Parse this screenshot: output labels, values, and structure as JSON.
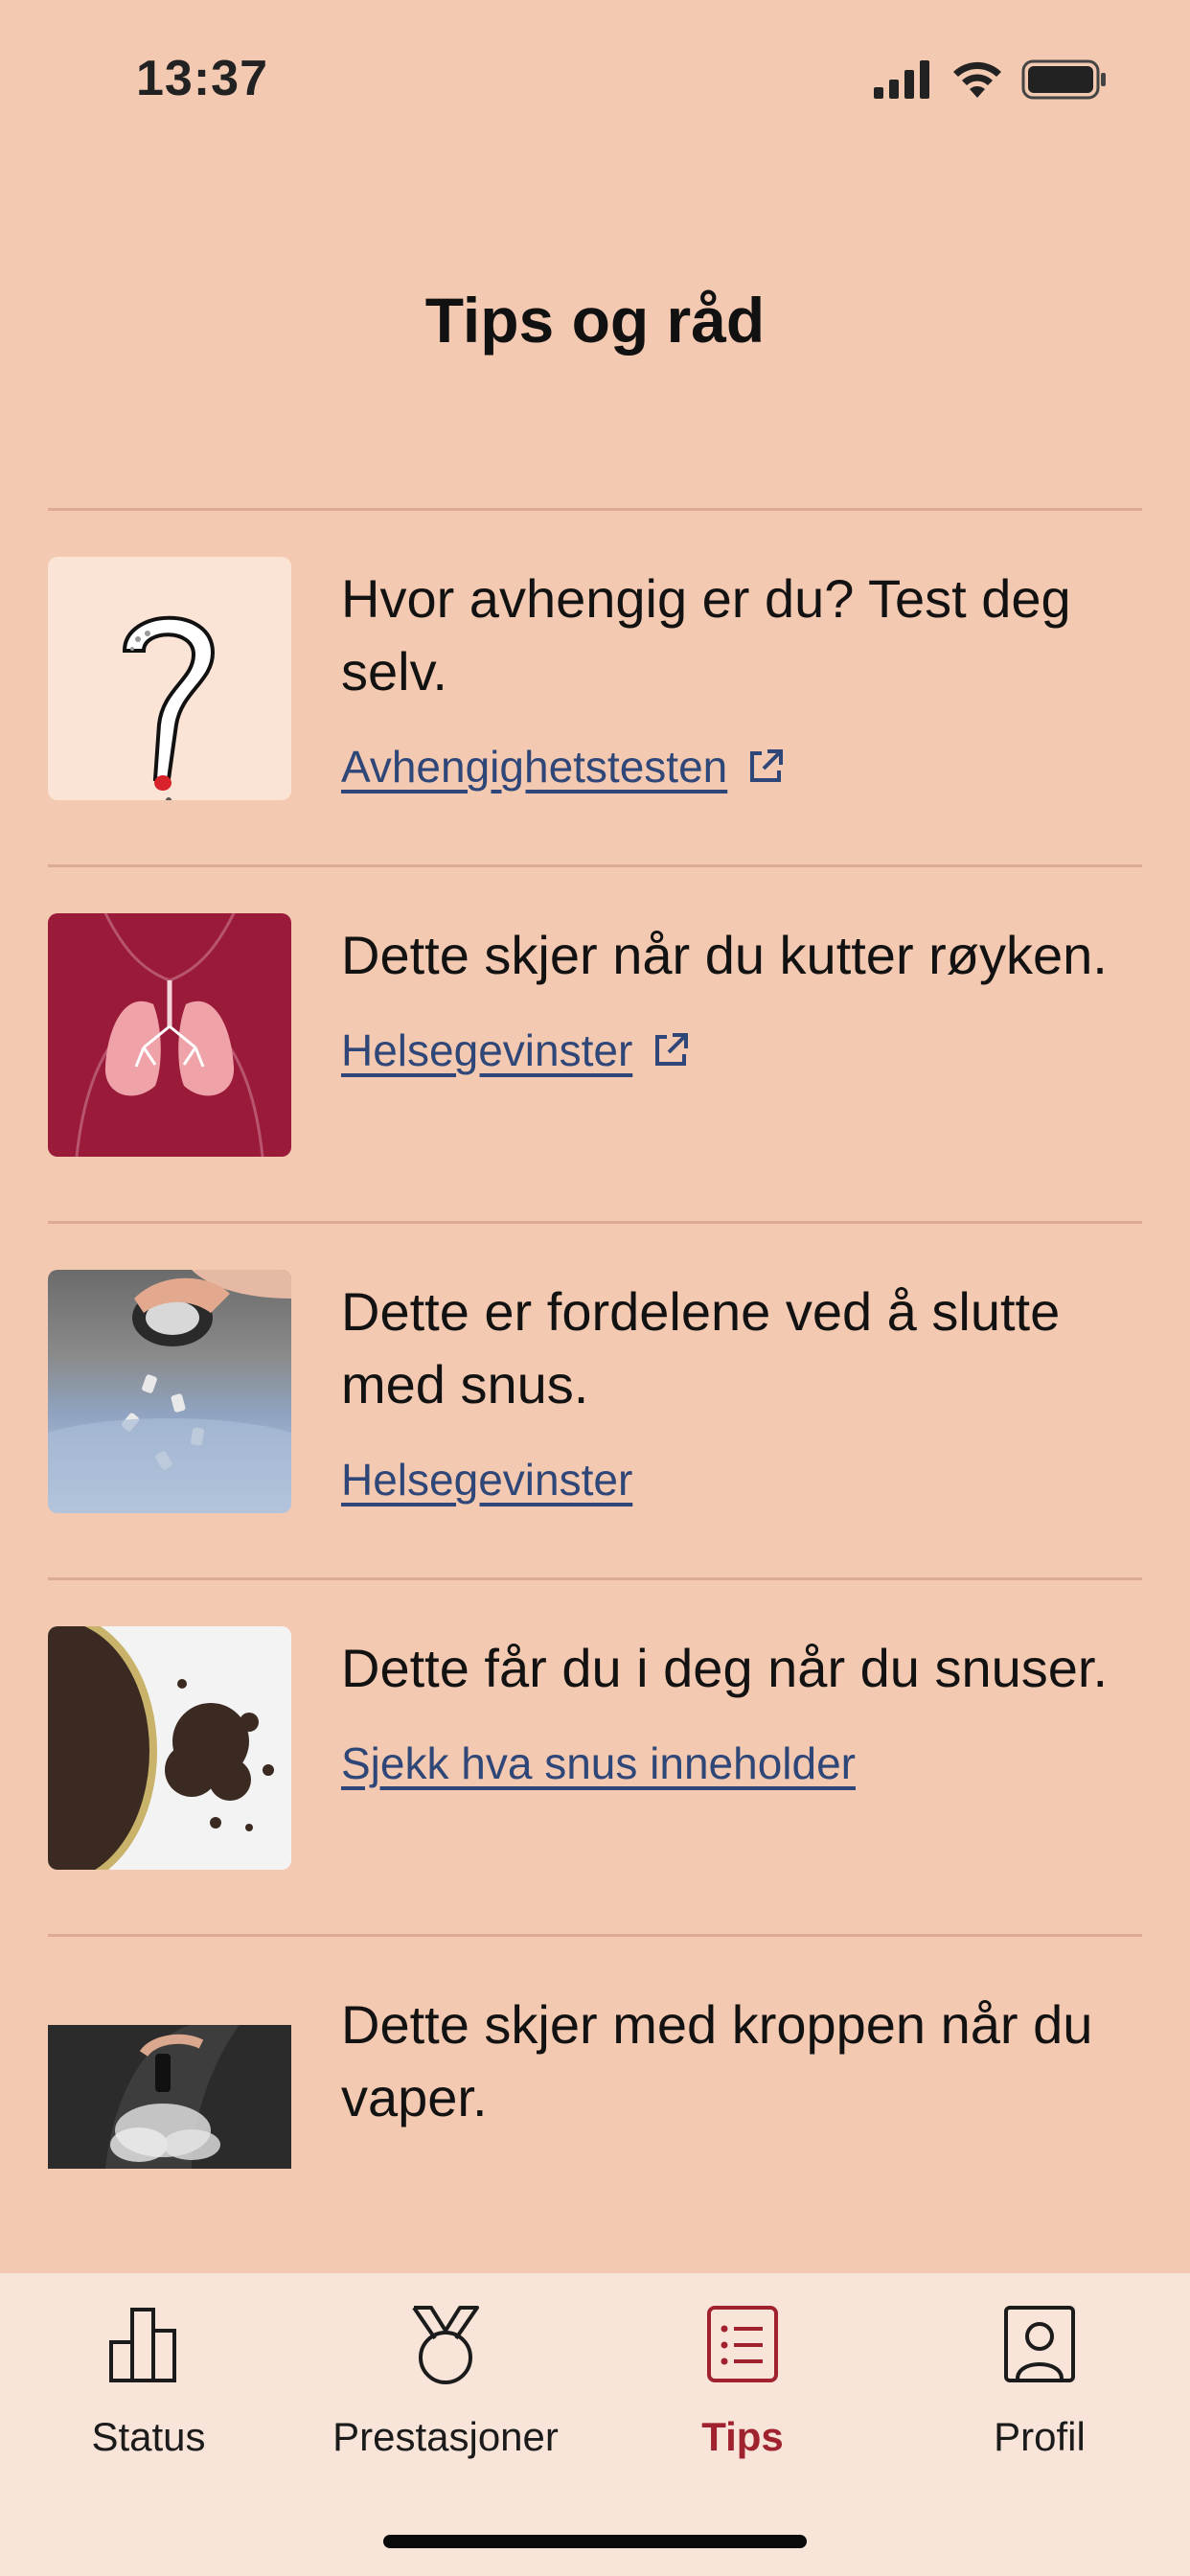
{
  "status_bar": {
    "time": "13:37"
  },
  "header": {
    "title": "Tips og råd"
  },
  "tips": [
    {
      "title": "Hvor avhengig er du? Test deg selv.",
      "link": "Avhengighetstesten",
      "external": true,
      "image": "question-cigarette-illustration"
    },
    {
      "title": "Dette skjer når du kutter røyken.",
      "link": "Helsegevinster",
      "external": true,
      "image": "lungs-illustration"
    },
    {
      "title": "Dette er fordelene ved å slutte med snus.",
      "link": "Helsegevinster",
      "external": false,
      "image": "snus-in-bin-photo"
    },
    {
      "title": "Dette får du i deg når du snuser.",
      "link": "Sjekk hva snus inneholder",
      "external": false,
      "image": "snus-tobacco-photo"
    },
    {
      "title": "Dette skjer med kroppen når du vaper.",
      "link": "",
      "external": false,
      "image": "vape-smoke-photo"
    }
  ],
  "tabbar": {
    "items": [
      {
        "label": "Status",
        "icon": "bar-chart-icon"
      },
      {
        "label": "Prestasjoner",
        "icon": "medal-icon"
      },
      {
        "label": "Tips",
        "icon": "list-icon",
        "active": true
      },
      {
        "label": "Profil",
        "icon": "profile-icon"
      }
    ]
  },
  "colors": {
    "background": "#F4C9B1",
    "tabbar": "#F8E4D8",
    "link": "#2E4778",
    "accent": "#A0222F",
    "divider": "#DDAA93"
  }
}
